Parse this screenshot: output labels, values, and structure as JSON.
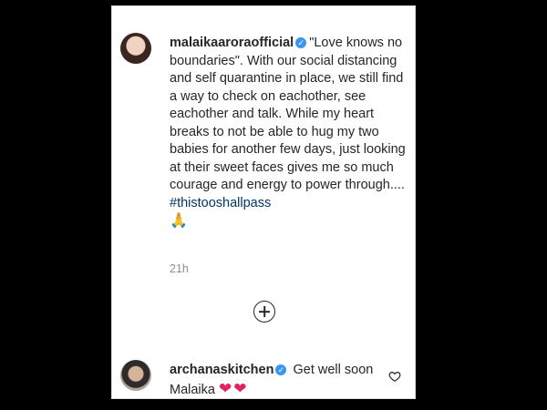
{
  "post": {
    "username": "malaikaaroraofficial",
    "caption": "\"Love knows no boundaries\". With our social distancing and self quarantine in place, we still find a way to check on eachother, see eachother and talk. While my heart breaks to not be able to hug my two babies for another few days, just looking at their sweet faces gives me so much courage and energy to power through....",
    "hashtag": "#thistooshallpass",
    "emoji": "🙏",
    "timestamp": "21h"
  },
  "comment": {
    "username": "archanaskitchen",
    "text": "Get well soon Malaika",
    "emoji": "❤❤"
  },
  "icons": {
    "verified": "verified-badge-icon",
    "load_more": "plus-circle-icon",
    "like": "heart-outline-icon"
  },
  "colors": {
    "verified": "#3897f0",
    "hashtag": "#003569",
    "heart": "#e0245e"
  }
}
